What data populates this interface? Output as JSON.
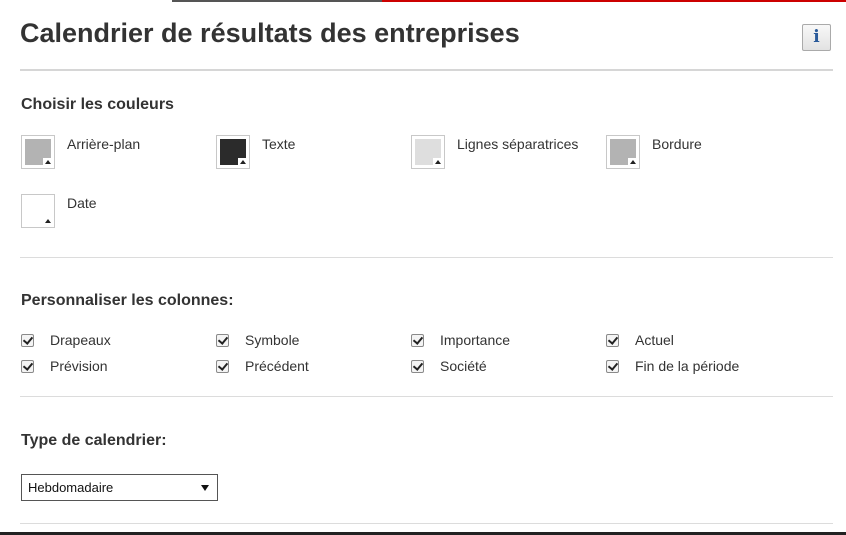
{
  "title": "Calendrier de résultats des entreprises",
  "info_button": {
    "icon": "info-icon",
    "glyph": "i",
    "color": "#2a5a9a"
  },
  "colors_section": {
    "title": "Choisir les couleurs",
    "swatches": [
      {
        "label": "Arrière-plan",
        "color": "#b3b3b3"
      },
      {
        "label": "Texte",
        "color": "#2b2b2b"
      },
      {
        "label": "Lignes séparatrices",
        "color": "#dedede"
      },
      {
        "label": "Bordure",
        "color": "#b3b3b3"
      },
      {
        "label": "Date",
        "color": "#ffffff"
      }
    ]
  },
  "columns_section": {
    "title": "Personnaliser les colonnes:",
    "options": [
      {
        "label": "Drapeaux",
        "checked": true
      },
      {
        "label": "Symbole",
        "checked": true
      },
      {
        "label": "Importance",
        "checked": true
      },
      {
        "label": "Actuel",
        "checked": true
      },
      {
        "label": "Prévision",
        "checked": true
      },
      {
        "label": "Précédent",
        "checked": true
      },
      {
        "label": "Société",
        "checked": true
      },
      {
        "label": "Fin de la période",
        "checked": true
      }
    ]
  },
  "calendar_type": {
    "title": "Type de calendrier:",
    "selected": "Hebdomadaire"
  }
}
